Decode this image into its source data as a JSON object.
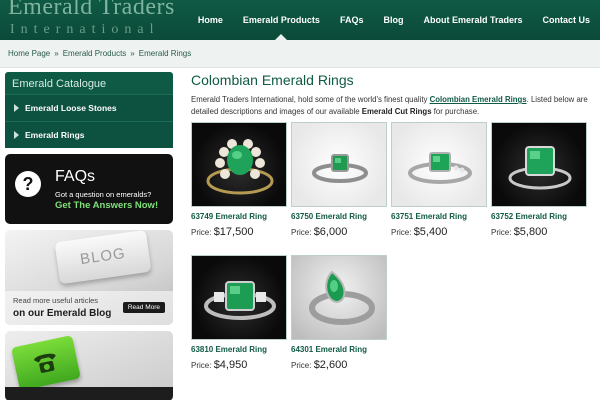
{
  "header": {
    "logo_main": "Emerald Traders",
    "logo_sub": "International",
    "nav": [
      "Home",
      "Emerald Products",
      "FAQs",
      "Blog",
      "About Emerald Traders",
      "Contact Us"
    ]
  },
  "breadcrumb": [
    "Home Page",
    "Emerald Products",
    "Emerald Rings"
  ],
  "sidebar": {
    "catalogue_title": "Emerald Catalogue",
    "items": [
      "Emerald Loose Stones",
      "Emerald Rings"
    ],
    "faq": {
      "title": "FAQs",
      "line1": "Got a question on emeralds?",
      "line2": "Get The Answers Now!"
    },
    "blog": {
      "key_label": "BLOG",
      "line1": "Read more useful articles",
      "line2": "on our Emerald Blog",
      "button": "Read More"
    }
  },
  "main": {
    "title": "Colombian Emerald Rings",
    "intro_1": "Emerald Traders International, hold some of the world's finest quality ",
    "intro_link": "Colombian Emerald Rings",
    "intro_2": ". Listed below are detailed descriptions and images of our available ",
    "intro_bold": "Emerald Cut Rings",
    "intro_3": " for purchase.",
    "price_label": "Price:",
    "products": [
      {
        "name": "63749 Emerald Ring",
        "price": "$17,500"
      },
      {
        "name": "63750 Emerald Ring",
        "price": "$6,000"
      },
      {
        "name": "63751 Emerald Ring",
        "price": "$5,400"
      },
      {
        "name": "63752 Emerald Ring",
        "price": "$5,800"
      },
      {
        "name": "63810 Emerald Ring",
        "price": "$4,950"
      },
      {
        "name": "64301 Emerald Ring",
        "price": "$2,600"
      }
    ]
  },
  "colors": {
    "brand_green": "#0f5a45",
    "emerald": "#1fa35a",
    "faq_accent": "#7fe07a"
  }
}
